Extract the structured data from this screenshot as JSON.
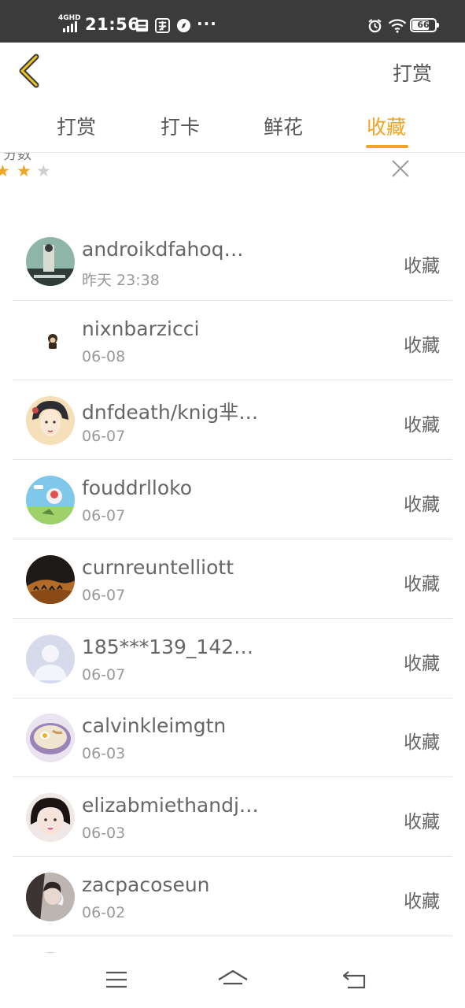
{
  "status_bar": {
    "network": "4GHD",
    "time": "21:56",
    "more": "···",
    "battery": "66"
  },
  "header": {
    "action": "打赏"
  },
  "tabs": [
    {
      "label": "打赏",
      "active": false
    },
    {
      "label": "打卡",
      "active": false
    },
    {
      "label": "鲜花",
      "active": false
    },
    {
      "label": "收藏",
      "active": true
    }
  ],
  "banner": {
    "partial_text": "分数",
    "rating_stars": 2
  },
  "list": [
    {
      "name": "androikdfahoq…",
      "date": "昨天 23:38",
      "action": "收藏",
      "avatar": "photo-shelf"
    },
    {
      "name": "nixnbarzicci",
      "date": "06-08",
      "action": "收藏",
      "avatar": "monkey"
    },
    {
      "name": "dnfdeath/knig芈…",
      "date": "06-07",
      "action": "收藏",
      "avatar": "anime-girl"
    },
    {
      "name": "fouddrlloko",
      "date": "06-07",
      "action": "收藏",
      "avatar": "cartoon-field"
    },
    {
      "name": "curnreuntelliott",
      "date": "06-07",
      "action": "收藏",
      "avatar": "desert-camels"
    },
    {
      "name": "185***139_142…",
      "date": "06-07",
      "action": "收藏",
      "avatar": "default-person"
    },
    {
      "name": "calvinkleimgtn",
      "date": "06-03",
      "action": "收藏",
      "avatar": "ramen-bowl"
    },
    {
      "name": "elizabmiethandj…",
      "date": "06-03",
      "action": "收藏",
      "avatar": "girl-portrait"
    },
    {
      "name": "zacpacoseun",
      "date": "06-02",
      "action": "收藏",
      "avatar": "person-smoke"
    }
  ],
  "colors": {
    "accent": "#f0a523",
    "text": "#666666",
    "subtext": "#999999",
    "divider": "#e6e6e6",
    "status_bar": "#3b3b3b"
  }
}
